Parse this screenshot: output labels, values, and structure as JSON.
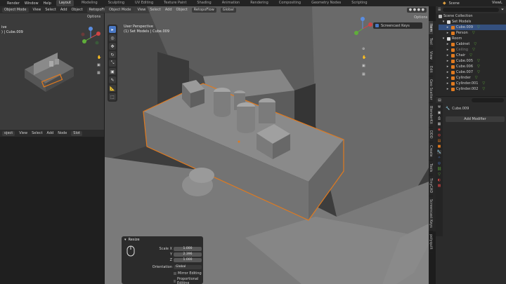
{
  "topbar": {
    "menus": [
      "Render",
      "Window",
      "Help"
    ],
    "workspaces": [
      "Layout",
      "Modeling",
      "Sculpting",
      "UV Editing",
      "Texture Paint",
      "Shading",
      "Animation",
      "Rendering",
      "Compositing",
      "Geometry Nodes",
      "Scripting"
    ],
    "active_workspace": "Layout",
    "scene_label": "Scene",
    "view_layer_label": "ViewL"
  },
  "left_viewport": {
    "mode": "Object Mode",
    "menus": [
      "View",
      "Select",
      "Add",
      "Object"
    ],
    "addon": "RetopoFlow",
    "options": "Options",
    "info_line1": "ive",
    "info_line2": ") | Cube.009"
  },
  "node_editor": {
    "type": "oject",
    "menus": [
      "View",
      "Select",
      "Add",
      "Node"
    ],
    "slot": "Slot"
  },
  "main_viewport": {
    "mode": "Object Mode",
    "menus": [
      "View",
      "Select",
      "Add",
      "Object"
    ],
    "addon": "RetopoFlow",
    "orientation": "Global",
    "options": "Options",
    "view_label": "User Perspective",
    "collection_label": "(1) Set Models | Cube.009",
    "screencast_keys": "Screencast Keys",
    "side_tabs": [
      "Item",
      "Tool",
      "View",
      "Edit",
      "Geo Scatter",
      "BlenderKit",
      "DDD",
      "Create",
      "Tools",
      "TinyCAD",
      "Screencast Keys",
      "polyquilt"
    ],
    "tools": [
      "▸",
      "◎",
      "✥",
      "↻",
      "⤡",
      "▣",
      "✎",
      "📐",
      "⬚"
    ]
  },
  "resize_panel": {
    "title": "Resize",
    "scale_x_label": "Scale X",
    "y_label": "Y",
    "z_label": "Z",
    "scale_x": "1.000",
    "scale_y": "2.396",
    "scale_z": "1.000",
    "orientation_label": "Orientation",
    "orientation_value": "Global",
    "mirror_editing": "Mirror Editing",
    "proportional_editing": "Proportional Editing"
  },
  "outliner": {
    "search_placeholder": "",
    "scene_collection": "Scene Collection",
    "set_models": "Set Models",
    "items_set": [
      {
        "name": "Cube.009",
        "selected": true
      },
      {
        "name": "Person",
        "selected": false
      }
    ],
    "room": "Room",
    "items_room": [
      "Cabinet",
      "Ceiling",
      "Chair",
      "Cube.005",
      "Cube.006",
      "Cube.007",
      "Cylinder",
      "Cylinder.001",
      "Cylinder.002"
    ]
  },
  "properties": {
    "object_name": "Cube.009",
    "add_modifier": "Add Modifier"
  },
  "colors": {
    "selection_orange": "#e07a1f",
    "accent_blue": "#4a78c4",
    "viewport_bg": "#3d3d3d"
  }
}
